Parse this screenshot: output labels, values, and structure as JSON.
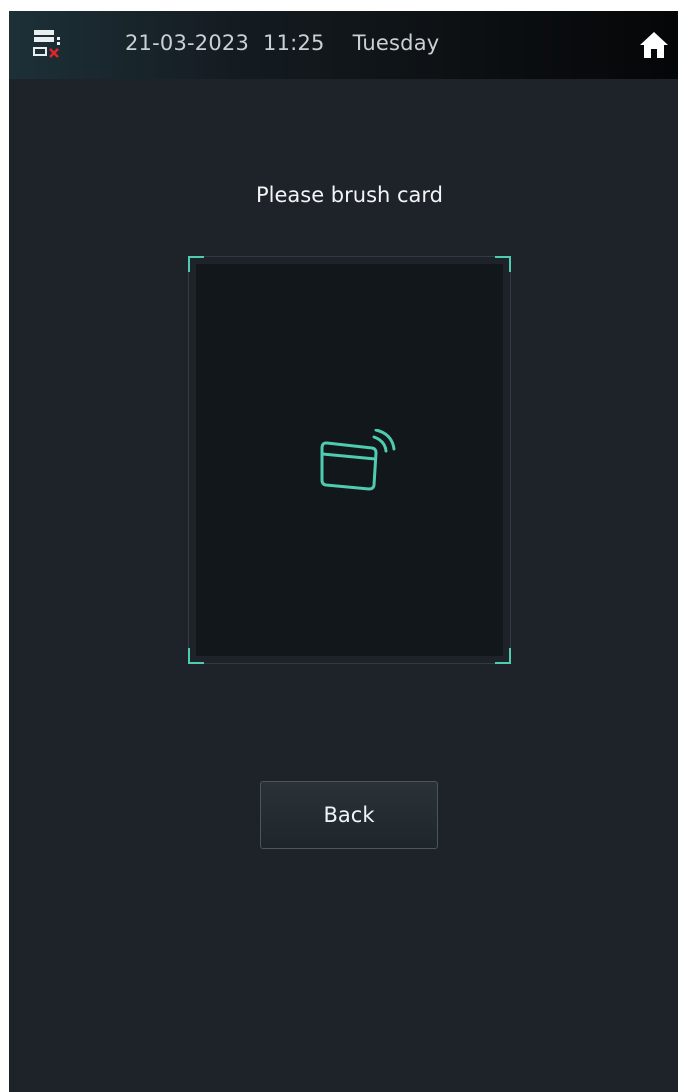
{
  "header": {
    "date": "21-03-2023",
    "time": "11:25",
    "day": "Tuesday",
    "network_icon": "network-disconnected-icon",
    "home_icon": "home-icon"
  },
  "main": {
    "prompt": "Please brush card",
    "card_icon": "contactless-card-icon",
    "back_label": "Back"
  },
  "colors": {
    "background": "#1e2329",
    "accent": "#4fcbb0",
    "error": "#e0262b",
    "text": "#f2f4f6"
  }
}
